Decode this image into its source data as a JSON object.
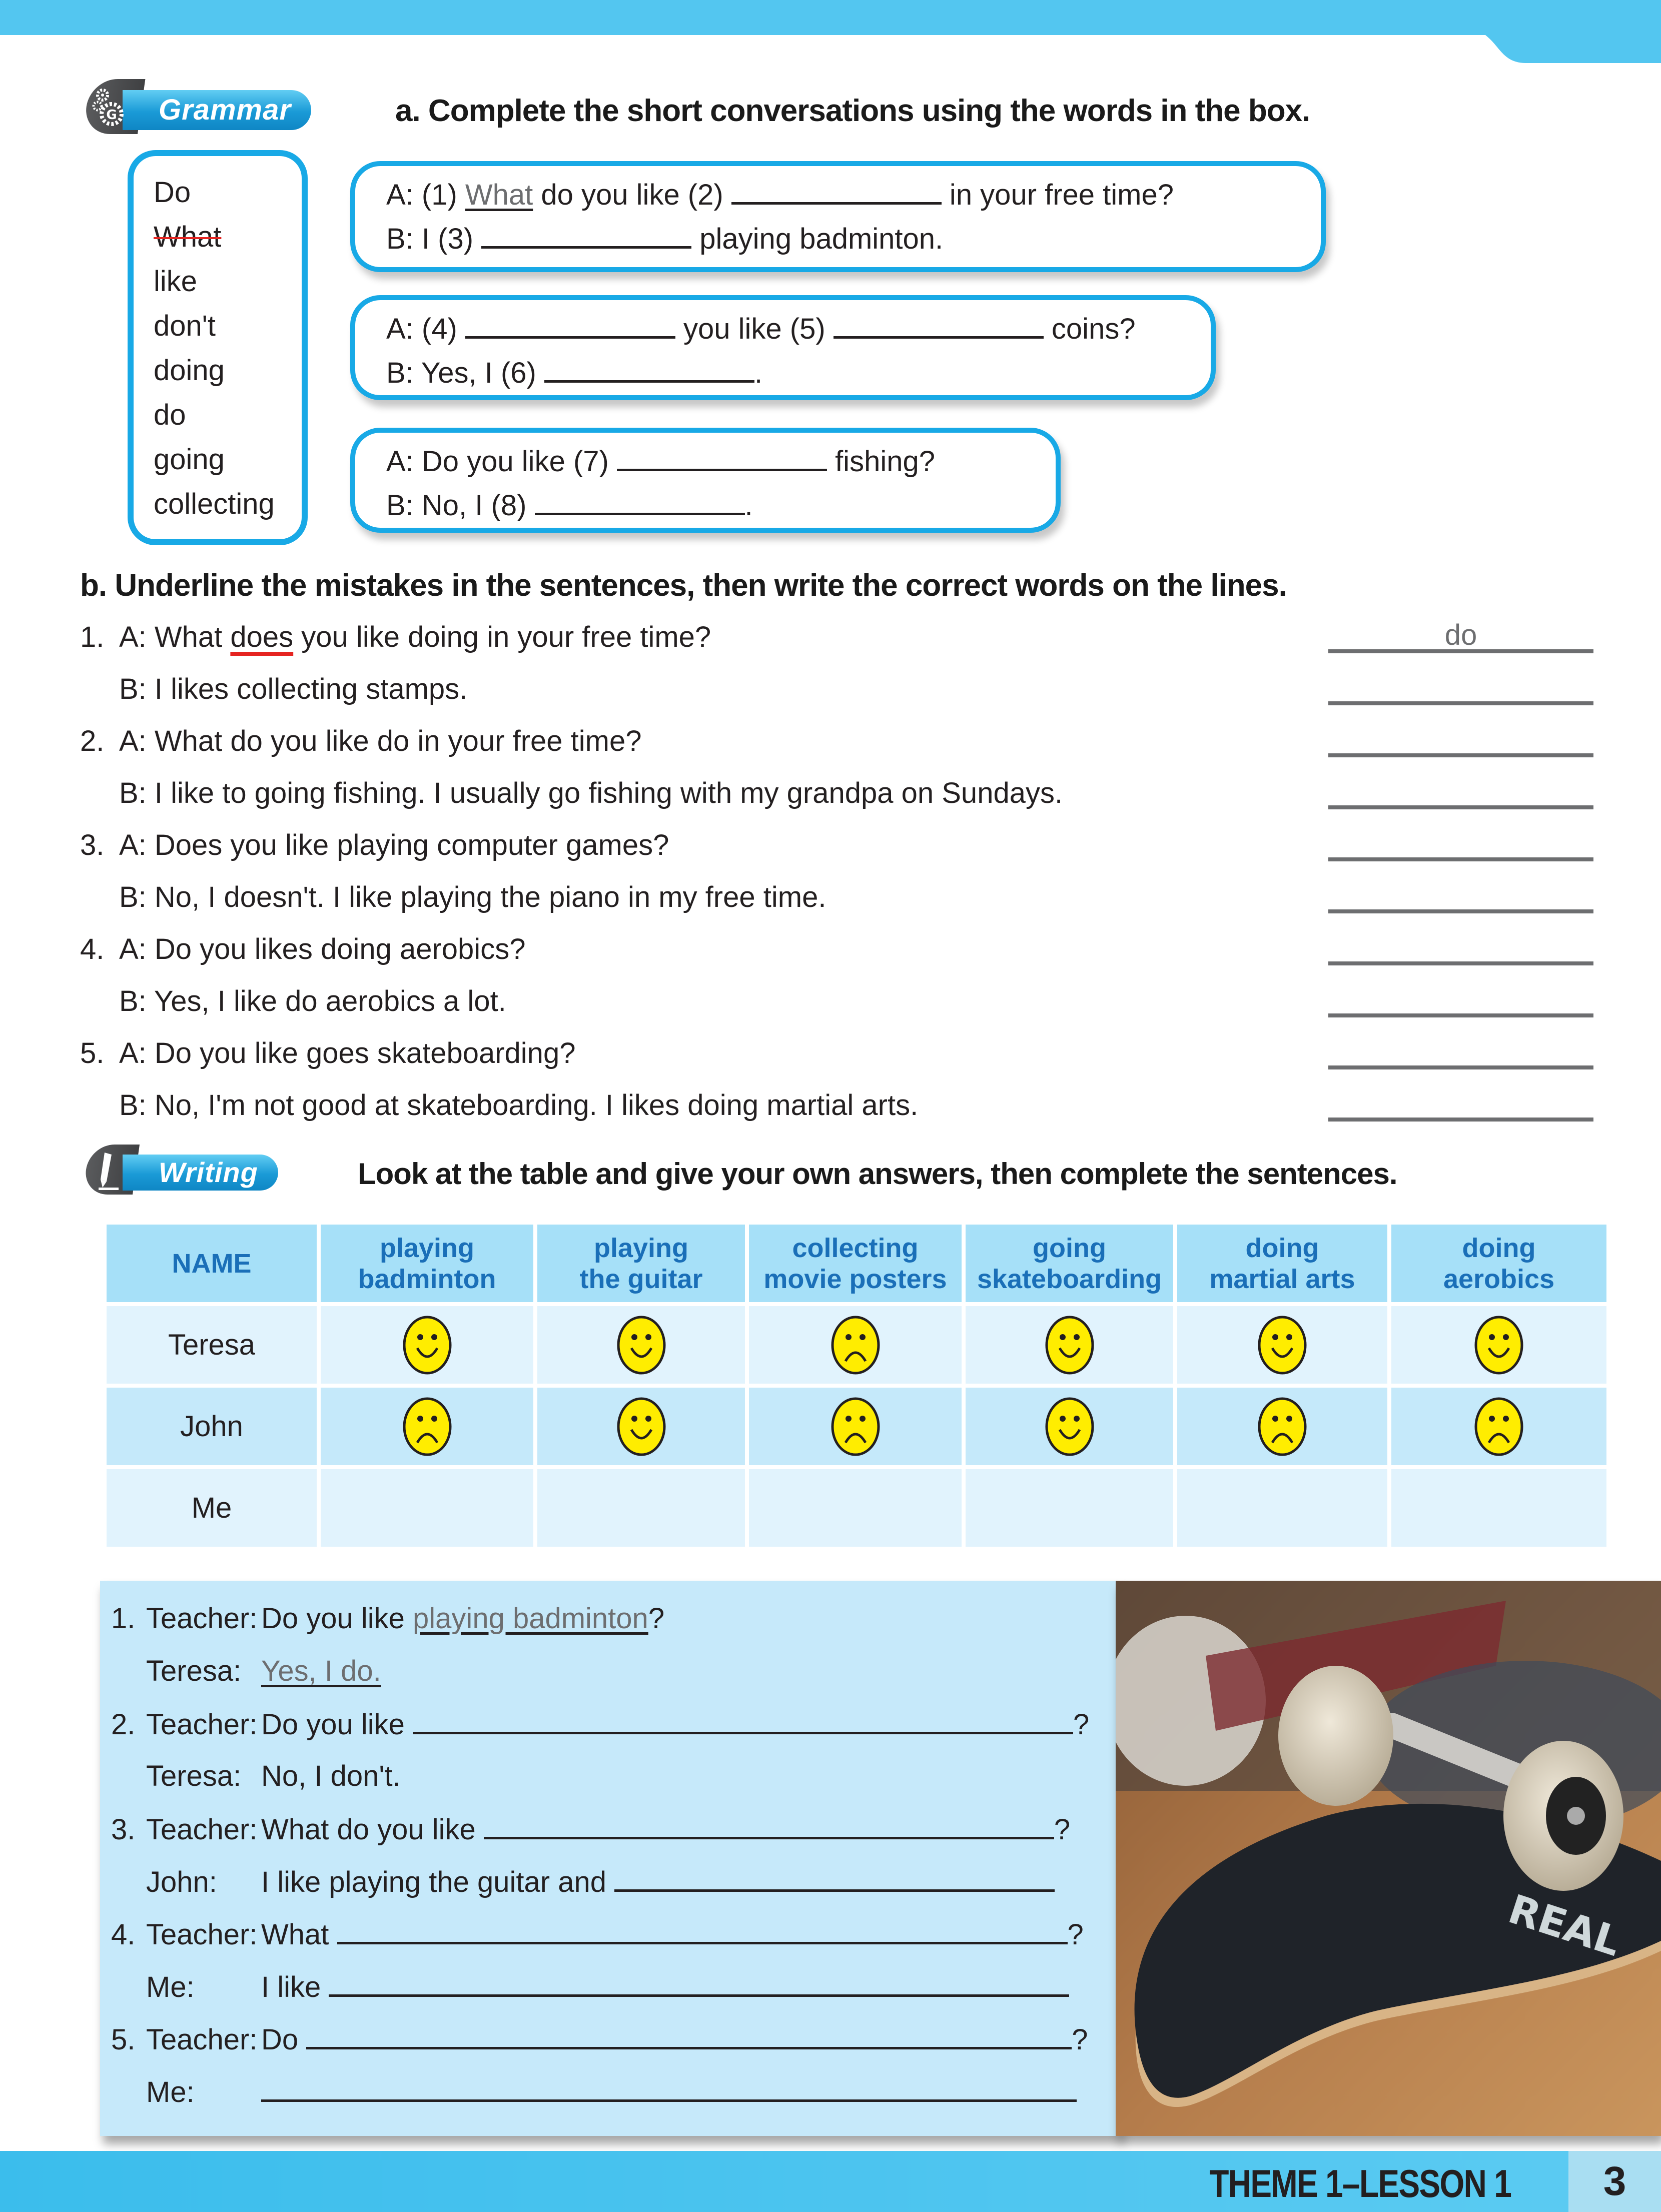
{
  "colors": {
    "accent": "#18a9e6",
    "banner": "#53c6f0",
    "header_text": "#1a6fb8",
    "mistake": "#e52421",
    "answer_grey": "#6d6e70",
    "panel": "#c6e9fa"
  },
  "grammar": {
    "badge_label": "Grammar",
    "badge_icon": "gears-icon",
    "instruction_a": "a. Complete the short conversations using the words in the box.",
    "word_box": [
      {
        "word": "Do",
        "struck": false
      },
      {
        "word": "What",
        "struck": true
      },
      {
        "word": "like",
        "struck": false
      },
      {
        "word": "don't",
        "struck": false
      },
      {
        "word": "doing",
        "struck": false
      },
      {
        "word": "do",
        "struck": false
      },
      {
        "word": "going",
        "struck": false
      },
      {
        "word": "collecting",
        "struck": false
      }
    ],
    "conversations": [
      {
        "a_parts": [
          "A: (1) ",
          "What",
          " do you like (2) ",
          " in your free time?"
        ],
        "b_parts": [
          "B: I (3) ",
          " playing badminton."
        ]
      },
      {
        "a_parts": [
          "A: (4) ",
          " you like (5) ",
          " coins?"
        ],
        "b_parts": [
          "B: Yes, I (6) ",
          "."
        ]
      },
      {
        "a_parts": [
          "A: Do you like (7) ",
          " fishing?"
        ],
        "b_parts": [
          "B: No, I (8) ",
          "."
        ]
      }
    ],
    "instruction_b": "b. Underline the mistakes in the sentences, then write the correct words on the lines.",
    "mistakes": [
      {
        "num": "1.",
        "a_pre": "A: What ",
        "a_mistake": "does",
        "a_post": " you like doing in your free time?",
        "a_answer": "do",
        "b": "B: I likes collecting stamps.",
        "b_answer": ""
      },
      {
        "num": "2.",
        "a_pre": "A: What do you like do in your free time?",
        "a_mistake": "",
        "a_post": "",
        "a_answer": "",
        "b": "B: I like to going fishing. I usually go fishing with my grandpa on Sundays.",
        "b_answer": ""
      },
      {
        "num": "3.",
        "a_pre": "A: Does you like playing computer games?",
        "a_mistake": "",
        "a_post": "",
        "a_answer": "",
        "b": "B: No, I doesn't. I like playing the piano in my free time.",
        "b_answer": ""
      },
      {
        "num": "4.",
        "a_pre": "A: Do you likes doing aerobics?",
        "a_mistake": "",
        "a_post": "",
        "a_answer": "",
        "b": "B: Yes, I like do aerobics a lot.",
        "b_answer": ""
      },
      {
        "num": "5.",
        "a_pre": "A: Do you like goes skateboarding?",
        "a_mistake": "",
        "a_post": "",
        "a_answer": "",
        "b": "B: No, I'm not good at skateboarding. I likes doing martial arts.",
        "b_answer": ""
      }
    ]
  },
  "writing": {
    "badge_label": "Writing",
    "badge_icon": "pencil-icon",
    "instruction": "Look at the table and give your own answers, then complete the sentences.",
    "table": {
      "name_header": "NAME",
      "activities": [
        [
          "playing",
          "badminton"
        ],
        [
          "playing",
          "the guitar"
        ],
        [
          "collecting",
          "movie posters"
        ],
        [
          "going",
          "skateboarding"
        ],
        [
          "doing",
          "martial arts"
        ],
        [
          "doing",
          "aerobics"
        ]
      ],
      "rows": [
        {
          "name": "Teresa",
          "faces": [
            "happy",
            "happy",
            "sad",
            "happy",
            "happy",
            "happy"
          ]
        },
        {
          "name": "John",
          "faces": [
            "sad",
            "happy",
            "sad",
            "happy",
            "sad",
            "sad"
          ]
        },
        {
          "name": "Me",
          "faces": [
            "",
            "",
            "",
            "",
            "",
            ""
          ]
        }
      ]
    },
    "dialogues": [
      {
        "n": "1.",
        "who": "Teacher:",
        "pre": "Do you like ",
        "answer": "playing badminton",
        "post": "?"
      },
      {
        "who": "Teresa:",
        "pre": "",
        "answer": "Yes, I do.",
        "post": ""
      },
      {
        "n": "2.",
        "who": "Teacher:",
        "pre": "Do you like ",
        "answer": "",
        "post": "?"
      },
      {
        "who": "Teresa:",
        "pre": "No, I don't.",
        "answer": "",
        "post": ""
      },
      {
        "n": "3.",
        "who": "Teacher:",
        "pre": "What do you like ",
        "answer": "",
        "post": "?"
      },
      {
        "who": "John:",
        "pre": "I like playing the guitar and ",
        "answer": "",
        "post": ""
      },
      {
        "n": "4.",
        "who": "Teacher:",
        "pre": "What ",
        "answer": "",
        "post": "?"
      },
      {
        "who": "Me:",
        "pre": "I like ",
        "answer": "",
        "post": ""
      },
      {
        "n": "5.",
        "who": "Teacher:",
        "pre": "Do ",
        "answer": "",
        "post": "?"
      },
      {
        "who": "Me:",
        "pre": "",
        "answer": "",
        "post": ""
      }
    ],
    "photo_alt": "skateboard-photo"
  },
  "footer": {
    "lesson": "THEME 1–LESSON 1",
    "page": "3"
  }
}
